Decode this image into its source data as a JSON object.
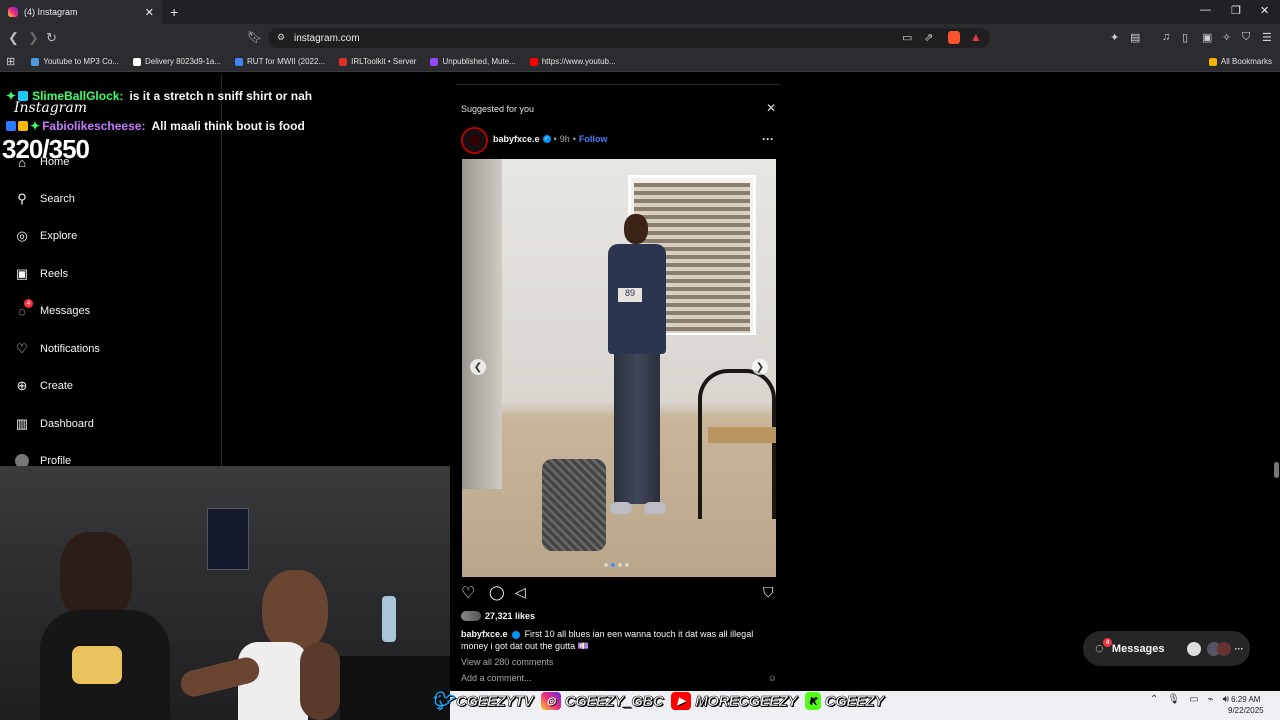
{
  "browser": {
    "tab_title": "(4) Instagram",
    "url": "instagram.com",
    "bookmarks": [
      {
        "label": "Youtube to MP3 Co...",
        "color": "#4a9be0"
      },
      {
        "label": "Delivery 8023d9-1a...",
        "color": "#ffffff"
      },
      {
        "label": "RUT for MWII (2022...",
        "color": "#4285f4"
      },
      {
        "label": "IRLToolkit • Server",
        "color": "#d93025"
      },
      {
        "label": "Unpublished, Mute...",
        "color": "#9147ff"
      },
      {
        "label": "https://www.youtub...",
        "color": "#ff0000"
      }
    ],
    "all_bookmarks": "All Bookmarks"
  },
  "overlay": {
    "chat": [
      {
        "user": "SlimeBallGlock:",
        "message": "is it a stretch n sniff shirt or nah",
        "color": "#39ff6a"
      },
      {
        "user": "Fabiolikescheese:",
        "message": "All maali think bout is food",
        "color": "#c27bff"
      }
    ],
    "counter": "320/350"
  },
  "sidebar": {
    "logo": "Instagram",
    "items": [
      {
        "label": "Home",
        "icon": "home-icon"
      },
      {
        "label": "Search",
        "icon": "search-icon"
      },
      {
        "label": "Explore",
        "icon": "compass-icon"
      },
      {
        "label": "Reels",
        "icon": "reels-icon"
      },
      {
        "label": "Messages",
        "icon": "messenger-icon",
        "badge": "4"
      },
      {
        "label": "Notifications",
        "icon": "heart-icon"
      },
      {
        "label": "Create",
        "icon": "plus-icon"
      },
      {
        "label": "Dashboard",
        "icon": "chart-icon"
      },
      {
        "label": "Profile",
        "icon": "avatar"
      }
    ]
  },
  "feed": {
    "suggested_label": "Suggested for you",
    "post": {
      "username": "babyfxce.e",
      "time": "9h",
      "follow": "Follow",
      "likes": "27,321 likes",
      "caption_user": "babyfxce.e",
      "caption_text": "First 10 all blues ian een wanna touch it dat was all illegal money i got dat out the gutta 💷",
      "view_comments": "View all 280 comments",
      "add_comment": "Add a comment..."
    }
  },
  "messages_pill": {
    "label": "Messages",
    "badge": "4"
  },
  "stream_socials": [
    {
      "platform": "twitter-icon",
      "handle": "CGEEZYTV",
      "color": "#1da1f2"
    },
    {
      "platform": "instagram-icon",
      "handle": "CGEEZY_GBC",
      "color": "#e1306c"
    },
    {
      "platform": "youtube-icon",
      "handle": "MORECGEEZY",
      "color": "#ff0000"
    },
    {
      "platform": "kick-icon",
      "handle": "CGEEZY",
      "color": "#53fc18"
    }
  ],
  "taskbar": {
    "time": "6:29 AM",
    "date": "9/22/2025"
  }
}
